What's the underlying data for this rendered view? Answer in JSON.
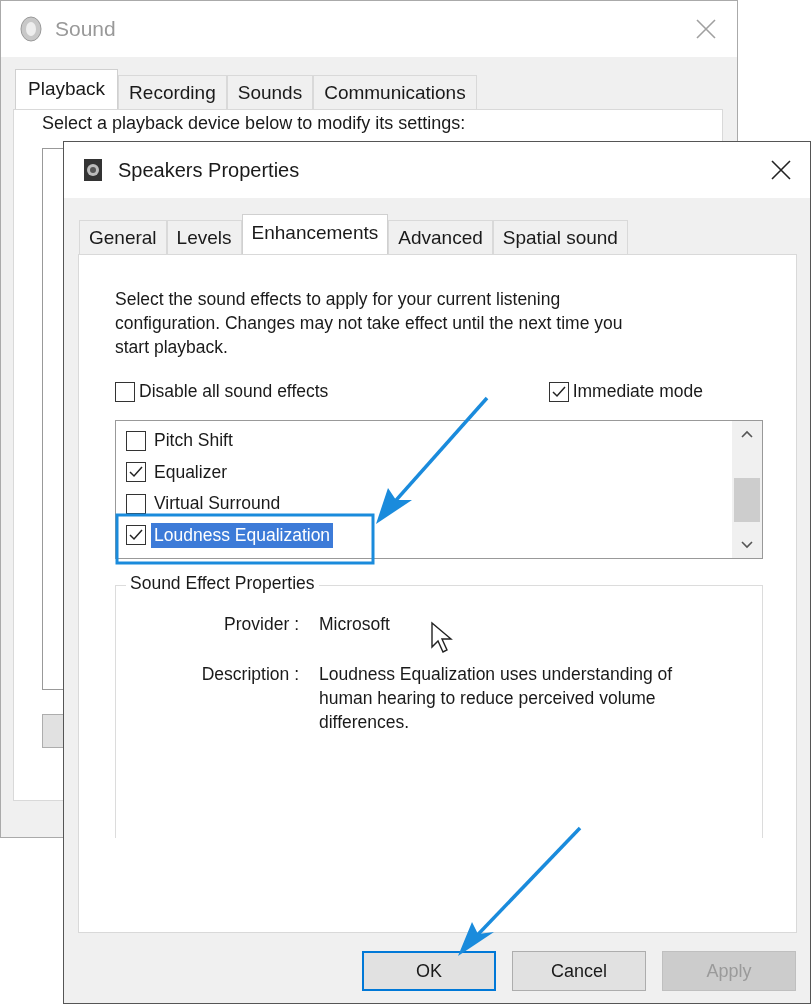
{
  "back_window": {
    "title": "Sound",
    "tabs": [
      {
        "label": "Playback",
        "selected": true
      },
      {
        "label": "Recording",
        "selected": false
      },
      {
        "label": "Sounds",
        "selected": false
      },
      {
        "label": "Communications",
        "selected": false
      }
    ],
    "instruction": "Select a playback device below to modify its settings:"
  },
  "dialog": {
    "title": "Speakers Properties",
    "tabs": [
      {
        "label": "General",
        "selected": false
      },
      {
        "label": "Levels",
        "selected": false
      },
      {
        "label": "Enhancements",
        "selected": true
      },
      {
        "label": "Advanced",
        "selected": false
      },
      {
        "label": "Spatial sound",
        "selected": false
      }
    ],
    "intro": "Select the sound effects to apply for your current listening configuration. Changes may not take effect until the next time you start playback.",
    "options": [
      {
        "label": "Disable all sound effects",
        "checked": false
      },
      {
        "label": "Immediate mode",
        "checked": true
      }
    ],
    "effects": [
      {
        "label": "Pitch Shift",
        "checked": false,
        "selected": false
      },
      {
        "label": "Equalizer",
        "checked": true,
        "selected": false
      },
      {
        "label": "Virtual Surround",
        "checked": false,
        "selected": false
      },
      {
        "label": "Loudness Equalization",
        "checked": true,
        "selected": true
      }
    ],
    "properties": {
      "title": "Sound Effect Properties",
      "rows": [
        {
          "label": "Provider :",
          "value": "Microsoft"
        },
        {
          "label": "Description :",
          "value": "Loudness Equalization uses understanding of human hearing to reduce perceived volume differences."
        }
      ]
    },
    "buttons": [
      {
        "label": "OK",
        "default": true,
        "disabled": false
      },
      {
        "label": "Cancel",
        "default": false,
        "disabled": false
      },
      {
        "label": "Apply",
        "default": false,
        "disabled": true
      }
    ]
  }
}
